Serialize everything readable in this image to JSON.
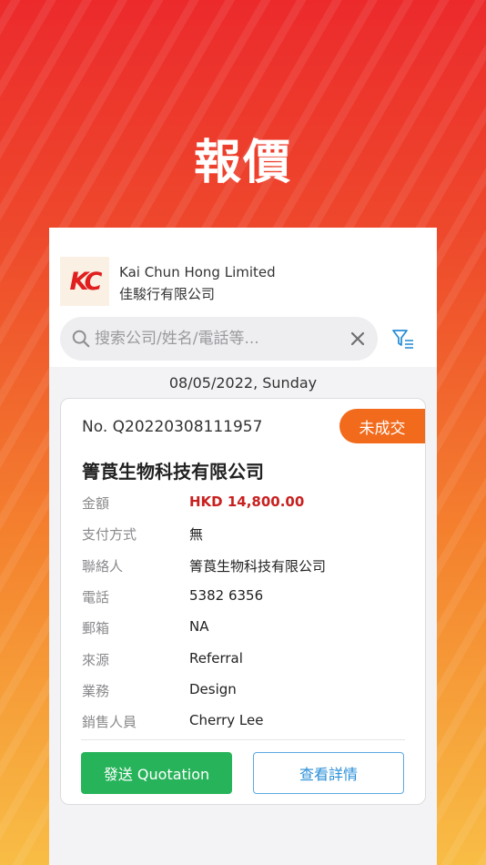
{
  "hero": {
    "title": "報價"
  },
  "header": {
    "logo_text": "KC",
    "company_en": "Kai Chun Hong Limited",
    "company_zh": "佳駿行有限公司"
  },
  "search": {
    "placeholder": "搜索公司/姓名/電話等...",
    "value": ""
  },
  "list": {
    "date_header": "08/05/2022, Sunday",
    "items": [
      {
        "quote_no": "No. Q20220308111957",
        "status": "未成交",
        "client": "箐莨生物科技有限公司",
        "fields": [
          {
            "label": "金額",
            "value": "HKD 14,800.00"
          },
          {
            "label": "支付方式",
            "value": "無"
          },
          {
            "label": "聯絡人",
            "value": "箐莨生物科技有限公司"
          },
          {
            "label": "電話",
            "value": "5382 6356"
          },
          {
            "label": "郵箱",
            "value": "NA"
          },
          {
            "label": "來源",
            "value": "Referral"
          },
          {
            "label": "業務",
            "value": "Design"
          },
          {
            "label": "銷售人員",
            "value": "Cherry Lee"
          }
        ],
        "send_label": "發送 Quotation",
        "detail_label": "查看詳情"
      }
    ]
  },
  "colors": {
    "accent_red": "#e01f1f",
    "status_orange": "#f26a1b",
    "amount_red": "#c8201f",
    "send_green": "#26b35a",
    "detail_blue": "#2a8fd8"
  },
  "icons": [
    "search-icon",
    "clear-icon",
    "filter-icon"
  ]
}
